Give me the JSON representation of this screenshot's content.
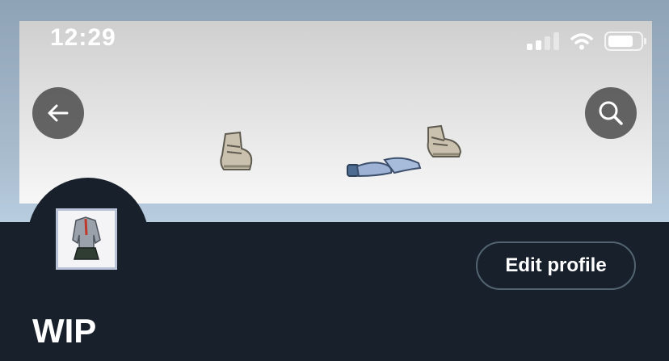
{
  "status_bar": {
    "time": "12:29",
    "icons": [
      "signal-icon",
      "wifi-icon",
      "battery-icon"
    ]
  },
  "header": {
    "back_icon": "arrow-left-icon",
    "search_icon": "search-icon"
  },
  "profile": {
    "edit_button_label": "Edit profile",
    "display_name": "WIP"
  },
  "colors": {
    "profile_background": "#17202b",
    "overlay_button": "#464646",
    "edit_button_border": "#536471",
    "text": "#ffffff"
  }
}
